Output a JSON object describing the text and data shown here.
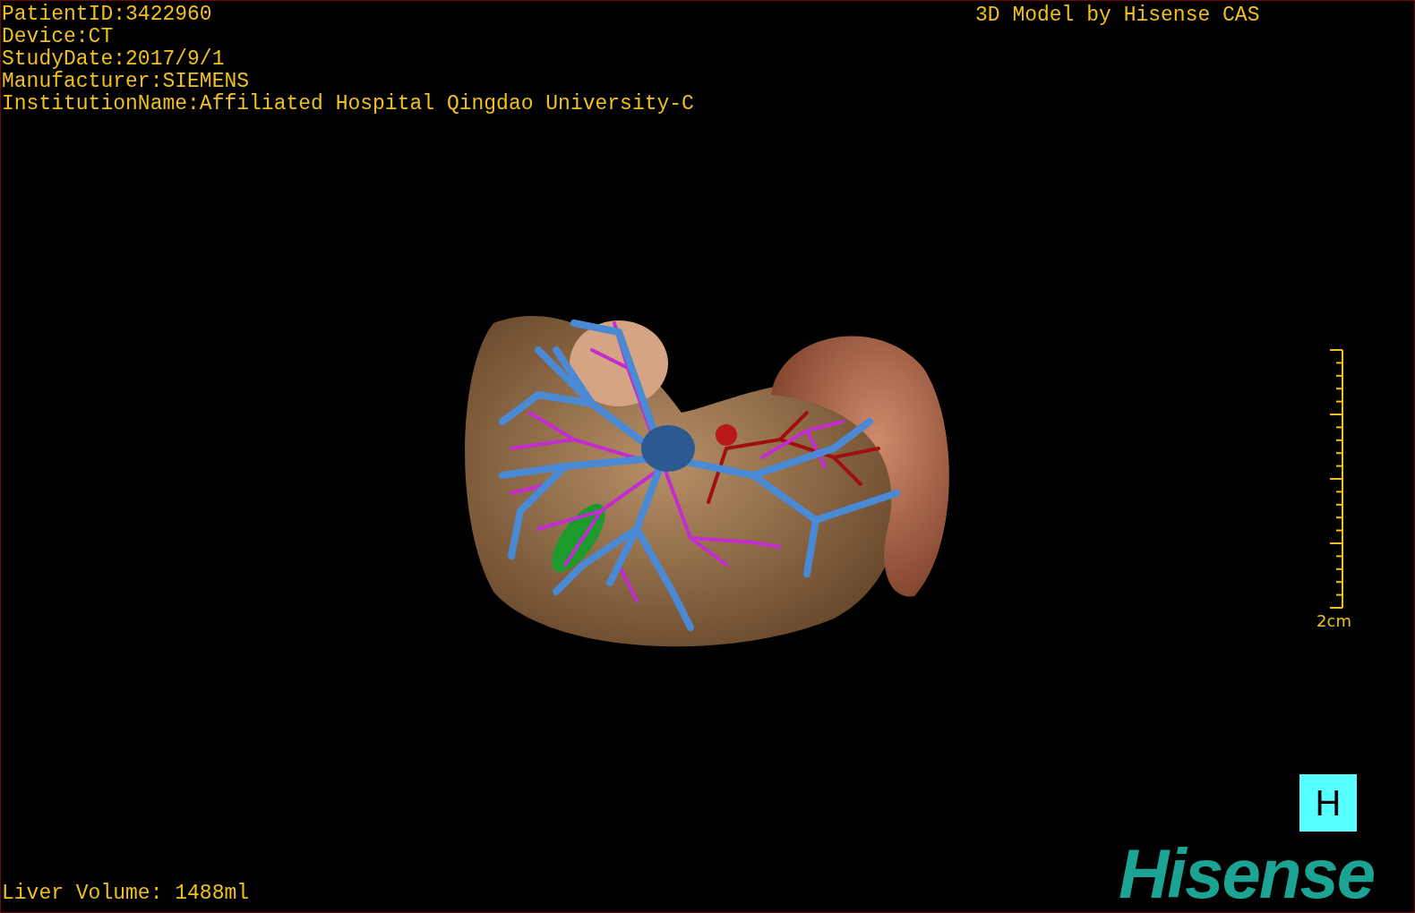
{
  "patient_info": [
    "PatientID:3422960",
    "Device:CT",
    "StudyDate:2017/9/1",
    "Manufacturer:SIEMENS",
    "InstitutionName:Affiliated Hospital Qingdao University-C"
  ],
  "title": "3D Model by Hisense CAS",
  "scale_bar": {
    "label": "2cm"
  },
  "orientation_marker": "H",
  "logo": "Hisense",
  "volume": "Liver Volume: 1488ml"
}
